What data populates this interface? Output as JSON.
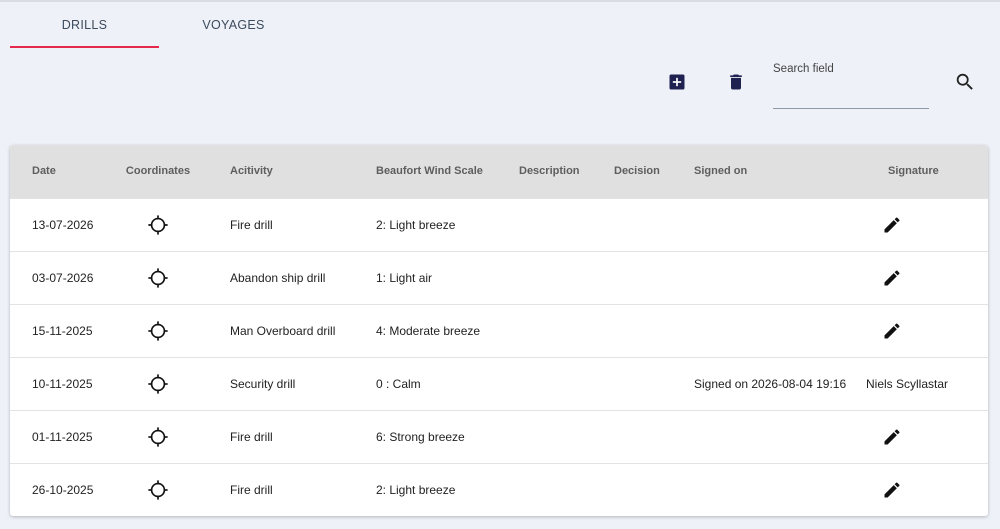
{
  "tabs": [
    {
      "label": "DRILLS",
      "active": true
    },
    {
      "label": "VOYAGES",
      "active": false
    }
  ],
  "toolbar": {
    "add_icon": "add-box-icon",
    "delete_icon": "trash-icon",
    "search_placeholder": "Search field",
    "search_value": "",
    "search_icon": "search-icon"
  },
  "table": {
    "headers": [
      "Date",
      "Coordinates",
      "Acitivity",
      "Beaufort Wind Scale",
      "Description",
      "Decision",
      "Signed on",
      "Signature"
    ],
    "rows": [
      {
        "date": "13-07-2026",
        "coordinates_icon": "crosshair-icon",
        "activity": "Fire drill",
        "beaufort": "2: Light breeze",
        "description": "",
        "decision": "",
        "signed_on": "",
        "signature": "",
        "signature_icon": "pencil-icon"
      },
      {
        "date": "03-07-2026",
        "coordinates_icon": "crosshair-icon",
        "activity": "Abandon ship drill",
        "beaufort": "1: Light air",
        "description": "",
        "decision": "",
        "signed_on": "",
        "signature": "",
        "signature_icon": "pencil-icon"
      },
      {
        "date": "15-11-2025",
        "coordinates_icon": "crosshair-icon",
        "activity": "Man Overboard drill",
        "beaufort": "4: Moderate breeze",
        "description": "",
        "decision": "",
        "signed_on": "",
        "signature": "",
        "signature_icon": "pencil-icon"
      },
      {
        "date": "10-11-2025",
        "coordinates_icon": "crosshair-icon",
        "activity": "Security drill",
        "beaufort": "0 : Calm",
        "description": "",
        "decision": "",
        "signed_on": "Signed on 2026-08-04 19:16",
        "signature": "Niels Scyllastar",
        "signature_icon": ""
      },
      {
        "date": "01-11-2025",
        "coordinates_icon": "crosshair-icon",
        "activity": "Fire drill",
        "beaufort": "6: Strong breeze",
        "description": "",
        "decision": "",
        "signed_on": "",
        "signature": "",
        "signature_icon": "pencil-icon"
      },
      {
        "date": "26-10-2025",
        "coordinates_icon": "crosshair-icon",
        "activity": "Fire drill",
        "beaufort": "2: Light breeze",
        "description": "",
        "decision": "",
        "signed_on": "",
        "signature": "",
        "signature_icon": "pencil-icon"
      }
    ]
  },
  "colors": {
    "background": "#eef2f8",
    "tab_indicator": "#e5294c",
    "toolbar_icon": "#1f2150",
    "header_bg": "#e0e0e0"
  }
}
